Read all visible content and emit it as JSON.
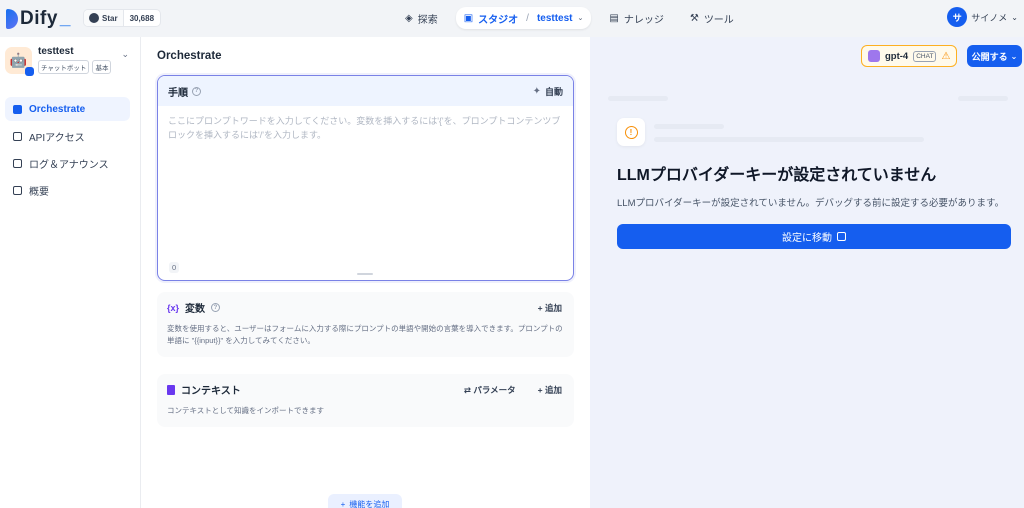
{
  "header": {
    "logo_text": "Dify",
    "github_label": "Star",
    "github_count": "30,688",
    "nav": {
      "explore": "探索",
      "studio": "スタジオ",
      "app_name": "testtest",
      "knowledge": "ナレッジ",
      "tools": "ツール"
    },
    "user_initial": "サ",
    "user_name": "サイノメ"
  },
  "sidebar": {
    "app_name": "testtest",
    "tags": [
      "チャットボット",
      "基本"
    ],
    "items": [
      {
        "label": "Orchestrate",
        "active": true
      },
      {
        "label": "APIアクセス",
        "active": false
      },
      {
        "label": "ログ＆アナウンス",
        "active": false
      },
      {
        "label": "概要",
        "active": false
      }
    ]
  },
  "main": {
    "title": "Orchestrate",
    "prompt": {
      "title": "手順",
      "auto_label": "自動",
      "placeholder": "ここにプロンプトワードを入力してください。変数を挿入するには'{'を、プロンプトコンテンツブロックを挿入するには'/'を入力します。",
      "char_count": "0"
    },
    "variables": {
      "title": "変数",
      "add_label": "追加",
      "description": "変数を使用すると、ユーザーはフォームに入力する際にプロンプトの単語や開始の言葉を導入できます。プロンプトの単語に \"{{input}}\" を入力してみてください。"
    },
    "context": {
      "title": "コンテキスト",
      "params_label": "パラメータ",
      "add_label": "追加",
      "description": "コンテキストとして知識をインポートできます"
    },
    "add_feature_label": "機能を追加"
  },
  "toolbar": {
    "model_name": "gpt-4",
    "model_mode": "CHAT",
    "publish_label": "公開する"
  },
  "preview": {
    "error_title": "LLMプロバイダーキーが設定されていません",
    "error_description": "LLMプロバイダーキーが設定されていません。デバッグする前に設定する必要があります。",
    "goto_label": "設定に移動"
  },
  "colors": {
    "accent": "#155eef",
    "warning": "#f79009",
    "purple": "#6938ef"
  }
}
